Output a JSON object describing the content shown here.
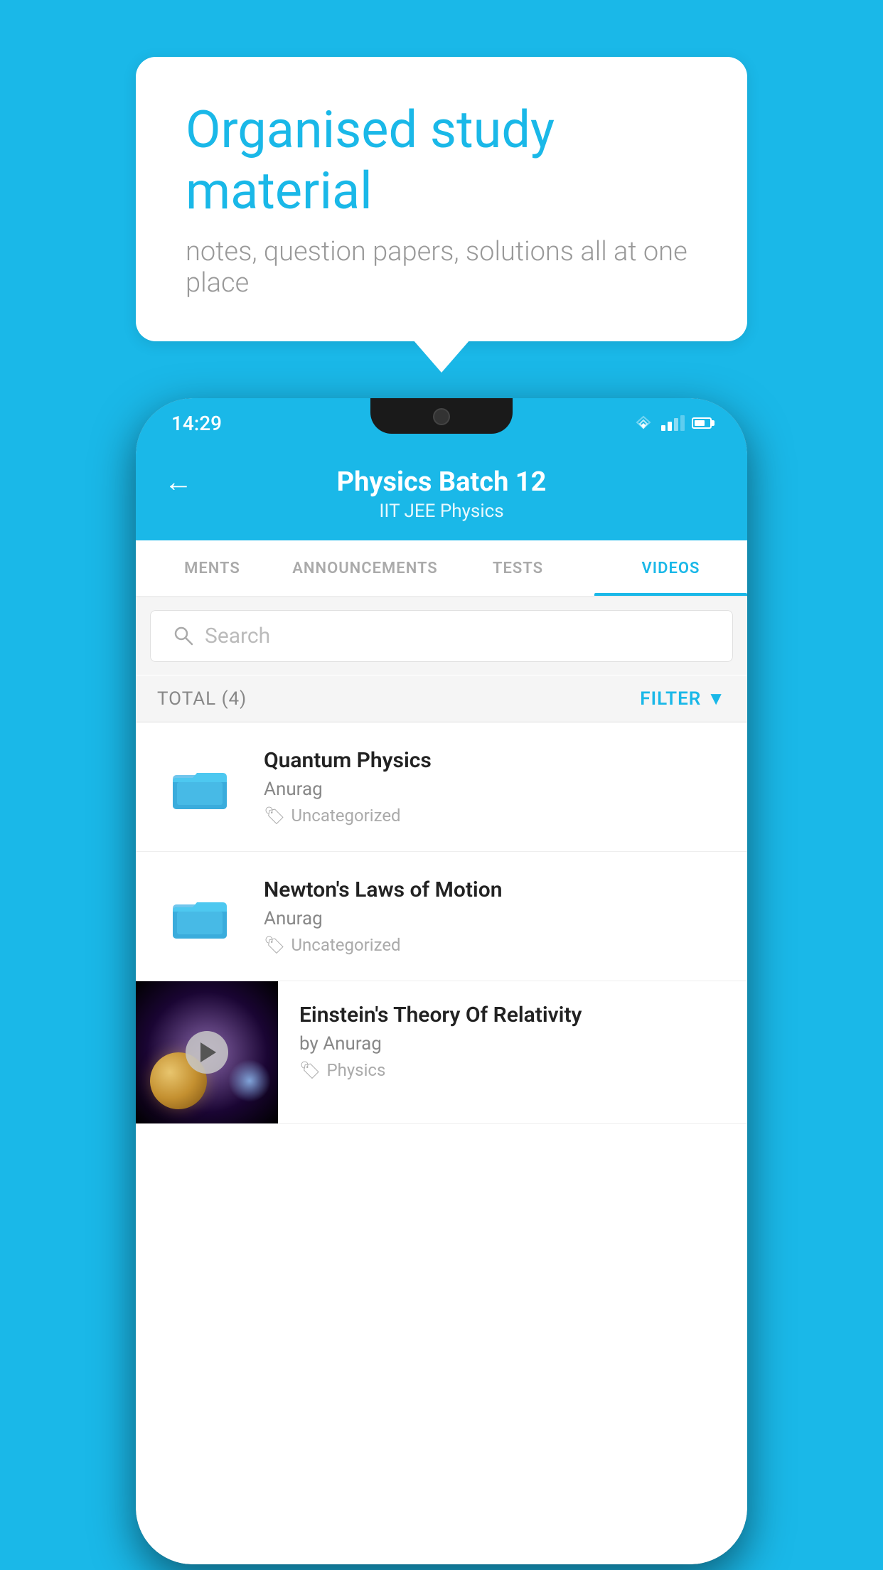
{
  "background_color": "#1ab8e8",
  "speech_bubble": {
    "title": "Organised study material",
    "subtitle": "notes, question papers, solutions all at one place"
  },
  "phone": {
    "status_bar": {
      "time": "14:29"
    },
    "header": {
      "title": "Physics Batch 12",
      "subtitle": "IIT JEE   Physics",
      "back_label": "←"
    },
    "tabs": [
      {
        "label": "MENTS",
        "active": false
      },
      {
        "label": "ANNOUNCEMENTS",
        "active": false
      },
      {
        "label": "TESTS",
        "active": false
      },
      {
        "label": "VIDEOS",
        "active": true
      }
    ],
    "search": {
      "placeholder": "Search"
    },
    "filter_bar": {
      "total_label": "TOTAL (4)",
      "filter_label": "FILTER"
    },
    "videos": [
      {
        "id": 1,
        "title": "Quantum Physics",
        "author": "Anurag",
        "tag": "Uncategorized",
        "type": "folder"
      },
      {
        "id": 2,
        "title": "Newton's Laws of Motion",
        "author": "Anurag",
        "tag": "Uncategorized",
        "type": "folder"
      },
      {
        "id": 3,
        "title": "Einstein's Theory Of Relativity",
        "author": "by Anurag",
        "tag": "Physics",
        "type": "video"
      }
    ]
  }
}
